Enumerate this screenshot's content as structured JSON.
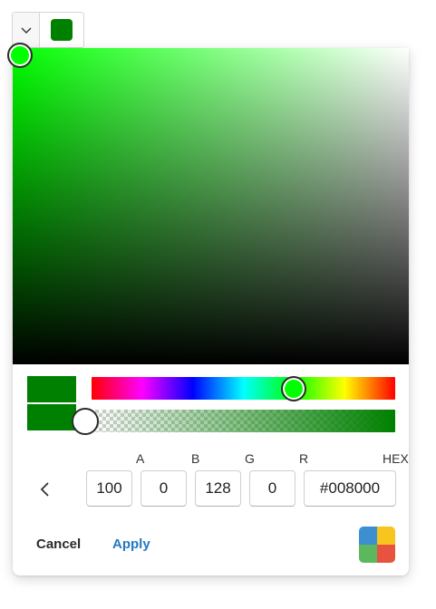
{
  "color": {
    "hex": "#008000",
    "hue_pure": "#00ff00",
    "alpha_percent": 100
  },
  "spectrum": {
    "saturation": 1,
    "value": 1
  },
  "hue_slider": {
    "hue_degrees": 120,
    "fraction": 0.6667
  },
  "alpha_slider": {
    "fraction": 0.0
  },
  "channels": {
    "a": {
      "label": "A",
      "value": "100"
    },
    "b": {
      "label": "B",
      "value": "0"
    },
    "g": {
      "label": "G",
      "value": "128"
    },
    "r": {
      "label": "R",
      "value": "0"
    },
    "hex": {
      "label": "HEX",
      "value": "#008000"
    }
  },
  "buttons": {
    "cancel": "Cancel",
    "apply": "Apply"
  },
  "icons": {
    "dropdown": "chevron-down-icon",
    "back": "chevron-left-icon",
    "palette": "palette-icon"
  },
  "palette_colors": [
    "#3d8fd1",
    "#f7c51e",
    "#5cb85c",
    "#e8533f"
  ]
}
